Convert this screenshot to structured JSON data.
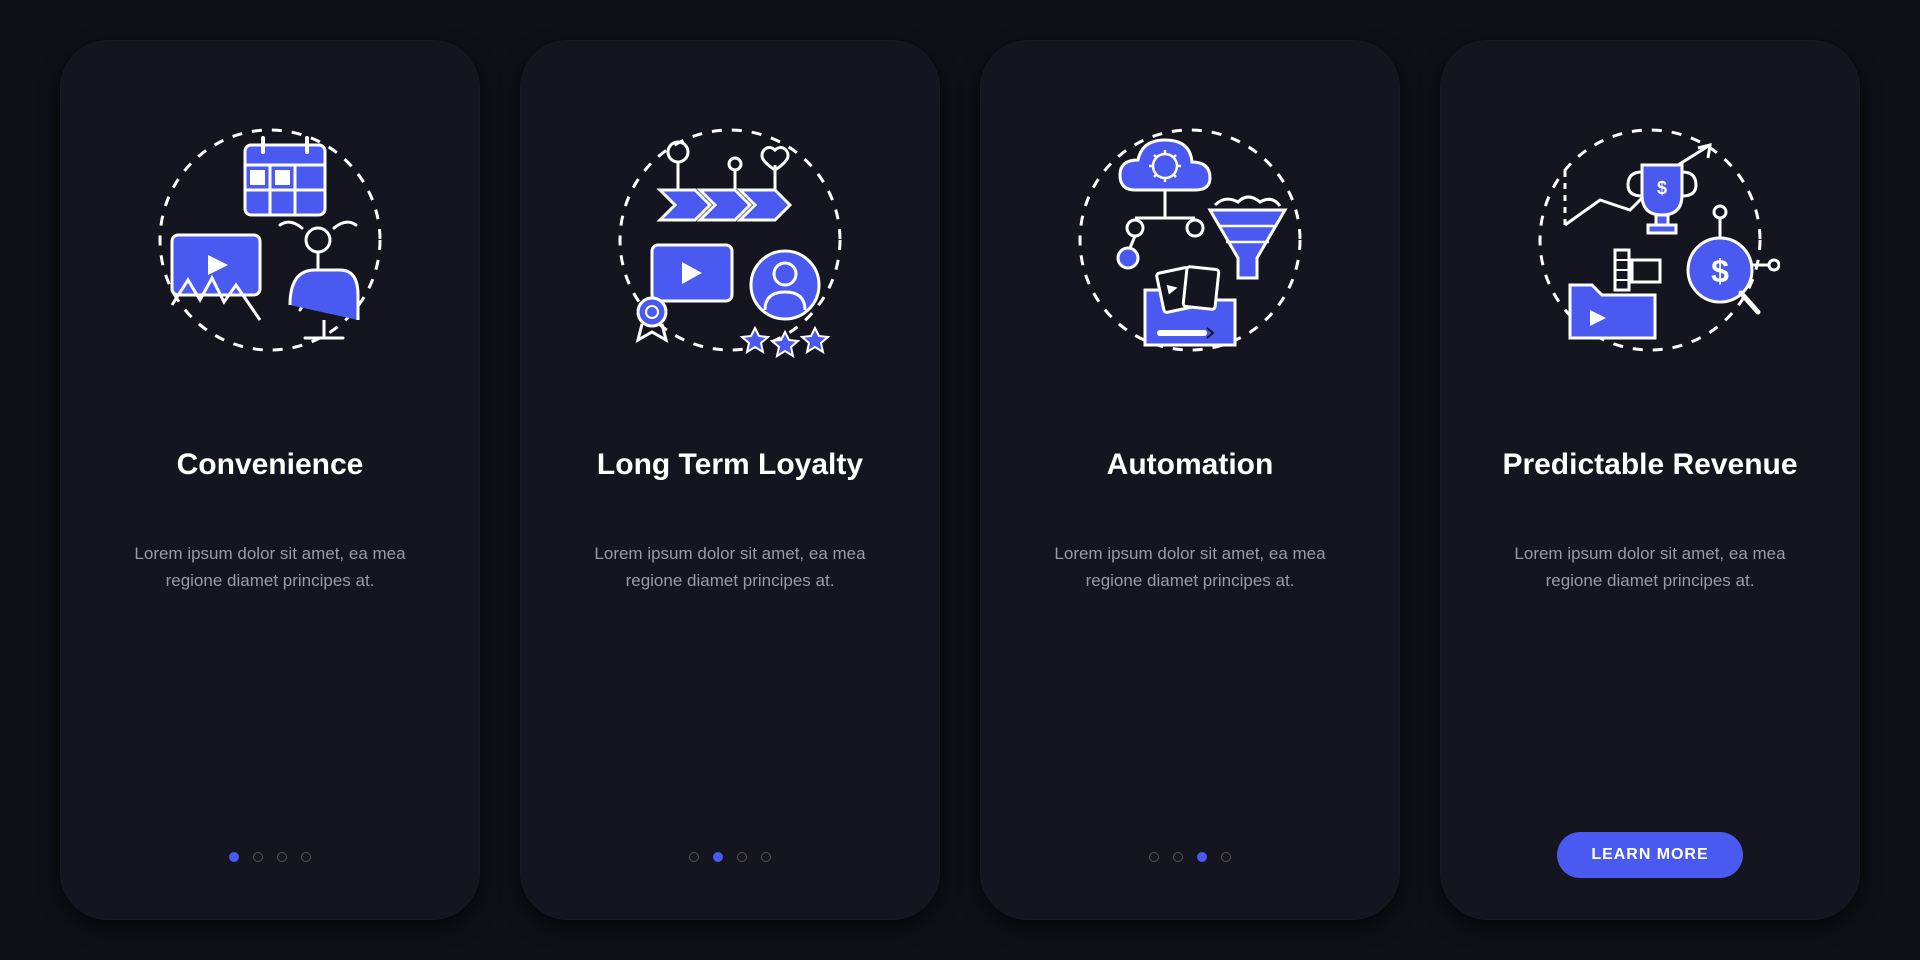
{
  "screens": [
    {
      "title": "Convenience",
      "desc": "Lorem ipsum dolor sit amet, ea mea regione diamet principes at.",
      "activeDot": 0,
      "hasCta": false
    },
    {
      "title": "Long Term Loyalty",
      "desc": "Lorem ipsum dolor sit amet, ea mea regione diamet principes at.",
      "activeDot": 1,
      "hasCta": false
    },
    {
      "title": "Automation",
      "desc": "Lorem ipsum dolor sit amet, ea mea regione diamet principes at.",
      "activeDot": 2,
      "hasCta": false
    },
    {
      "title": "Predictable Revenue",
      "desc": "Lorem ipsum dolor sit amet, ea mea regione diamet principes at.",
      "activeDot": 3,
      "hasCta": true
    }
  ],
  "ctaLabel": "LEARN MORE",
  "colors": {
    "accent": "#4a5af0",
    "cardBg": "#15151f",
    "pageBg": "#0f0f18",
    "text": "#ffffff",
    "muted": "#9a9aa5"
  }
}
